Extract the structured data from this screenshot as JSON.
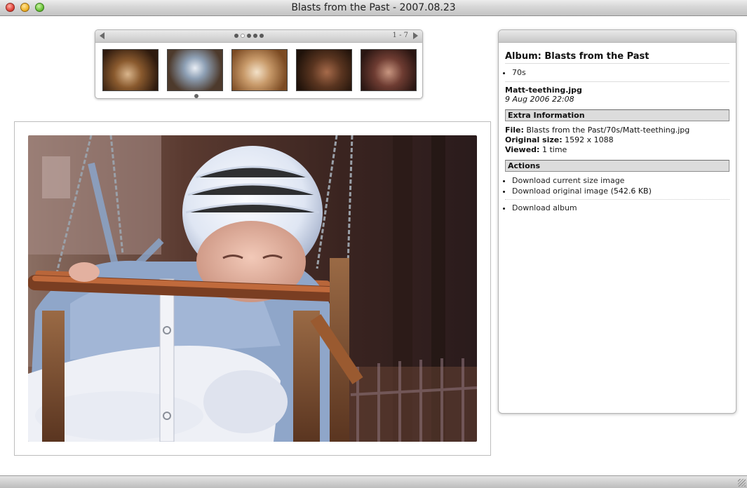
{
  "window": {
    "title": "Blasts from the Past - 2007.08.23"
  },
  "strip": {
    "page_range": "1 - 7",
    "page_dots": 5,
    "active_dot": 1,
    "thumbnails": [
      {
        "name": "thumbnail-1"
      },
      {
        "name": "thumbnail-2"
      },
      {
        "name": "thumbnail-3"
      },
      {
        "name": "thumbnail-4"
      },
      {
        "name": "thumbnail-5"
      }
    ]
  },
  "panel": {
    "album_title": "Album: Blasts from the Past",
    "subalbums": [
      "70s"
    ],
    "file_name": "Matt-teething.jpg",
    "file_date": "9 Aug 2006 22:08",
    "extra_heading": "Extra Information",
    "file_label": "File:",
    "file_value": "Blasts from the Past/70s/Matt-teething.jpg",
    "size_label": "Original size:",
    "size_value": "1592 x 1088",
    "viewed_label": "Viewed:",
    "viewed_value": "1 time",
    "actions_heading": "Actions",
    "download_current": "Download current size image",
    "download_original": "Download original image",
    "download_original_size": "(542.6 KB)",
    "download_album": "Download album"
  }
}
